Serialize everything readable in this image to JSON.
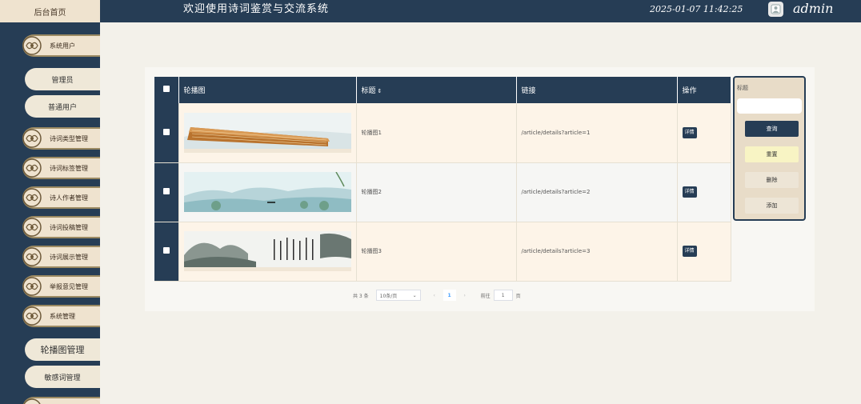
{
  "header": {
    "home_tab": "后台首页",
    "system_title": "欢迎使用诗词鉴赏与交流系统",
    "datetime": "2025-01-07 11:42:25",
    "username": "admin"
  },
  "sidebar": {
    "items": [
      {
        "label": "系统用户",
        "type": "group"
      },
      {
        "label": "管理员",
        "type": "sub"
      },
      {
        "label": "普通用户",
        "type": "sub"
      },
      {
        "label": "诗词类型管理",
        "type": "group"
      },
      {
        "label": "诗词标签管理",
        "type": "group"
      },
      {
        "label": "诗人作者管理",
        "type": "group"
      },
      {
        "label": "诗词投稿管理",
        "type": "group"
      },
      {
        "label": "诗词展示管理",
        "type": "group"
      },
      {
        "label": "举报意见管理",
        "type": "group"
      },
      {
        "label": "系统管理",
        "type": "group"
      },
      {
        "label": "轮播图管理",
        "type": "sub"
      },
      {
        "label": "敏感词管理",
        "type": "sub"
      }
    ]
  },
  "table": {
    "columns": [
      "轮播图",
      "标题",
      "链接",
      "操作"
    ],
    "sort_icon": "⇕",
    "rows": [
      {
        "title": "轮播图1",
        "link": "/article/details?article=1",
        "action": "详情",
        "image": "guqin-instrument"
      },
      {
        "title": "轮播图2",
        "link": "/article/details?article=2",
        "action": "详情",
        "image": "ink-landscape-boat"
      },
      {
        "title": "轮播图3",
        "link": "/article/details?article=3",
        "action": "详情",
        "image": "ink-mountain-calligraphy"
      }
    ]
  },
  "search": {
    "label": "标题",
    "placeholder": "",
    "buttons": {
      "query": "查询",
      "reset": "重置",
      "delete": "删除",
      "add": "添加"
    }
  },
  "pagination": {
    "total_text": "共 3 条",
    "page_size": "10条/页",
    "current_page": "1",
    "goto_label": "前往",
    "goto_value": "1",
    "page_unit": "页"
  },
  "colors": {
    "navy": "#263d55",
    "cream": "#efe3cf",
    "panel": "#f8f7f3"
  }
}
